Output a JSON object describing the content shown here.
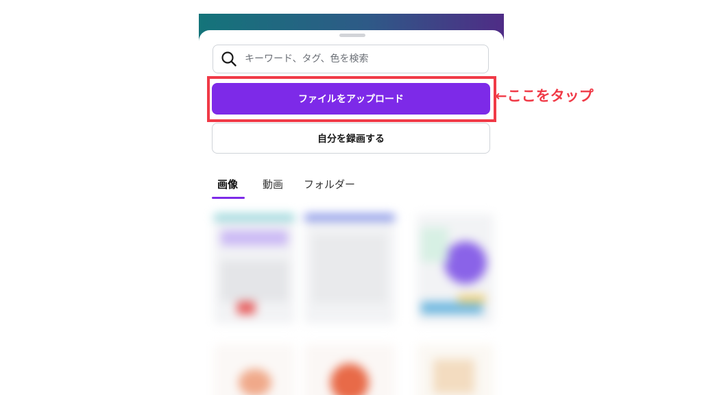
{
  "search": {
    "placeholder": "キーワード、タグ、色を検索",
    "icon": "search-icon"
  },
  "buttons": {
    "upload_label": "ファイルをアップロード",
    "record_label": "自分を録画する"
  },
  "tabs": [
    {
      "label": "画像",
      "active": true
    },
    {
      "label": "動画",
      "active": false
    },
    {
      "label": "フォルダー",
      "active": false
    }
  ],
  "annotation": {
    "text": "←ここをタップ"
  },
  "colors": {
    "accent": "#7d2ae8",
    "highlight": "#f03a47",
    "banner_start": "#14747a",
    "banner_end": "#4f2c86"
  }
}
